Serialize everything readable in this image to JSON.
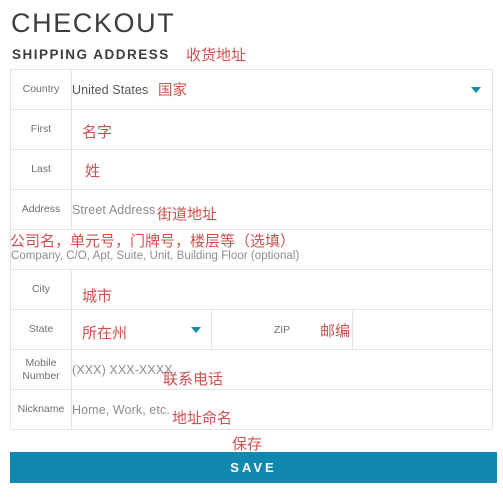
{
  "header": {
    "title": "CHECKOUT",
    "section_title": "SHIPPING ADDRESS",
    "section_title_annotation": "收货地址"
  },
  "colors": {
    "accent": "#1189ae",
    "annotation_red": "#cf5050",
    "border": "#e3e3e3",
    "label_text": "#6f6f6f",
    "placeholder_text": "#8d8d8d"
  },
  "form": {
    "rows": [
      {
        "label": "Country",
        "value": "United States",
        "annotation": "国家",
        "type": "select",
        "caret_icon": "chevron-down-icon"
      },
      {
        "label": "First",
        "value": "",
        "annotation": "名字",
        "type": "text"
      },
      {
        "label": "Last",
        "value": "",
        "annotation": "姓",
        "type": "text"
      },
      {
        "label": "Address",
        "value": "Street Address",
        "annotation": "街道地址",
        "type": "text"
      },
      {
        "label": "",
        "value": "Company, C/O, Apt, Suite, Unit, Building Floor (optional)",
        "annotation": "公司名，单元号，门牌号，楼层等（选填）",
        "type": "text-fullwidth"
      },
      {
        "label": "City",
        "value": "",
        "annotation": "城市",
        "type": "text"
      },
      {
        "label": "State",
        "value": "",
        "annotation": "所在州",
        "type": "select-split",
        "caret_icon": "chevron-down-icon",
        "second_label": "ZIP",
        "second_value": "",
        "second_annotation": "邮编"
      },
      {
        "label": "Mobile Number",
        "label_line1": "Mobile",
        "label_line2": "Number",
        "value": "(XXX) XXX-XXXX",
        "annotation": "联系电话",
        "type": "tel"
      },
      {
        "label": "Nickname",
        "value": "Home, Work, etc.",
        "annotation": "地址命名",
        "type": "text"
      }
    ]
  },
  "actions": {
    "save_label": "SAVE",
    "save_annotation": "保存"
  }
}
